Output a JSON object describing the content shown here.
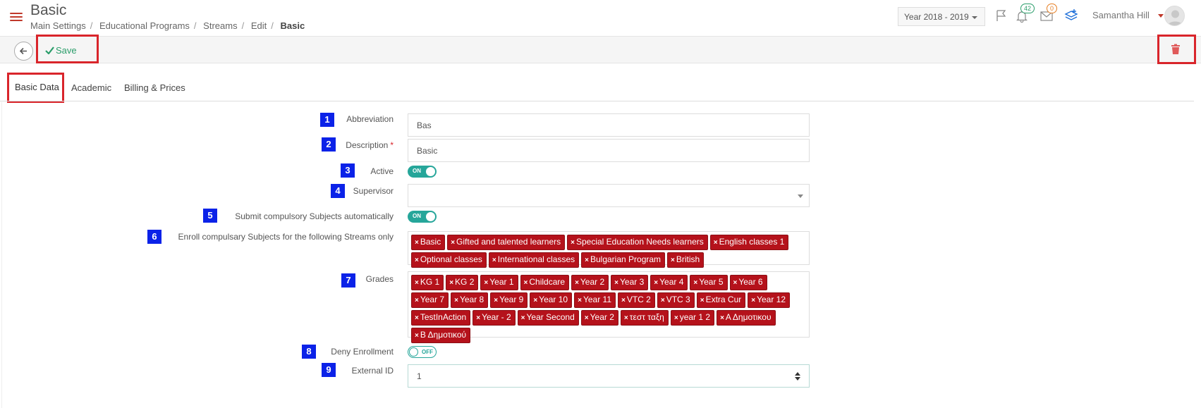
{
  "header": {
    "title": "Basic",
    "breadcrumb": [
      "Main Settings",
      "Educational Programs",
      "Streams",
      "Edit"
    ],
    "breadcrumb_active": "Basic",
    "year": "Year 2018 - 2019",
    "notifications_count": "42",
    "messages_count": "0",
    "user_name": "Samantha Hill"
  },
  "toolbar": {
    "save_label": "Save"
  },
  "tabs": [
    {
      "label": "Basic Data",
      "active": true
    },
    {
      "label": "Academic"
    },
    {
      "label": "Billing & Prices"
    }
  ],
  "form": {
    "abbreviation": {
      "num": "1",
      "label": "Abbreviation",
      "value": "Bas"
    },
    "description": {
      "num": "2",
      "label": "Description",
      "required": "*",
      "value": "Basic"
    },
    "active": {
      "num": "3",
      "label": "Active",
      "state": "ON"
    },
    "supervisor": {
      "num": "4",
      "label": "Supervisor",
      "value": ""
    },
    "submit_auto": {
      "num": "5",
      "label": "Submit compulsory Subjects automatically",
      "state": "ON"
    },
    "enroll_streams": {
      "num": "6",
      "label": "Enroll compulsary Subjects for the following Streams only",
      "tags": [
        "Basic",
        "Gifted and talented learners",
        "Special Education Needs learners",
        "English classes 1",
        "Optional classes",
        "International classes",
        "Bulgarian Program",
        "British"
      ]
    },
    "grades": {
      "num": "7",
      "label": "Grades",
      "tags": [
        "KG 1",
        "KG 2",
        "Year 1",
        "Childcare",
        "Year 2",
        "Year 3",
        "Year 4",
        "Year 5",
        "Year 6",
        "Year 7",
        "Year 8",
        "Year 9",
        "Year 10",
        "Year 11",
        "VTC 2",
        "VTC 3",
        "Extra Cur",
        "Year 12",
        "TestInAction",
        "Year - 2",
        "Year Second",
        "Year 2",
        "τεστ ταξη",
        "year 1 2",
        "Α Δημοτικου",
        "Β Δημοτικού"
      ]
    },
    "deny_enrollment": {
      "num": "8",
      "label": "Deny Enrollment",
      "state": "OFF"
    },
    "external_id": {
      "num": "9",
      "label": "External ID",
      "value": "1"
    }
  },
  "colors": {
    "accent": "#c0392b",
    "tag": "#b5121b",
    "toggle": "#26a69a",
    "save": "#2a9d6a",
    "badge_blue": "#0b22e8",
    "highlight": "#d9252b"
  }
}
